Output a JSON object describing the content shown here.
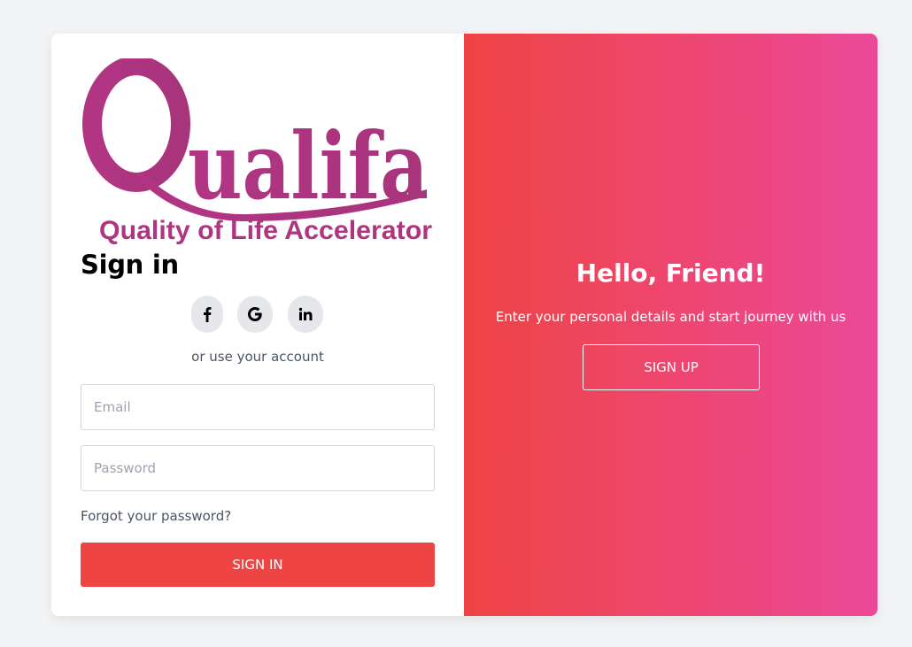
{
  "brand": {
    "name": "Qualifa",
    "tagline": "Quality of Life Accelerator",
    "color": "#b0357f"
  },
  "signin": {
    "title": "Sign in",
    "socials": [
      {
        "name": "facebook-icon",
        "glyph": "f"
      },
      {
        "name": "google-icon",
        "glyph": "G"
      },
      {
        "name": "linkedin-icon",
        "glyph": "in"
      }
    ],
    "alt_text": "or use your account",
    "email_placeholder": "Email",
    "email_value": "",
    "password_placeholder": "Password",
    "password_value": "",
    "forgot_label": "Forgot your password?",
    "button_label": "SIGN IN",
    "button_color": "#ef4444"
  },
  "panel": {
    "title": "Hello, Friend!",
    "subtitle": "Enter your personal details and start journey with us",
    "button_label": "SIGN UP",
    "gradient_start": "#ef4444",
    "gradient_end": "#ec4899"
  }
}
